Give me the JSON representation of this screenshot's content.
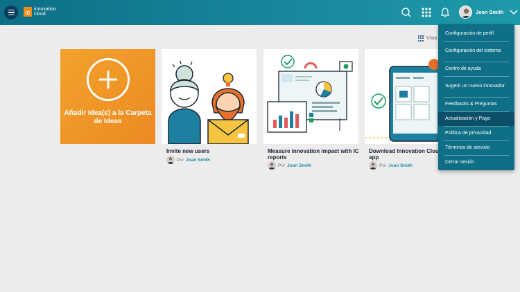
{
  "header": {
    "logo_text_line1": "innovation",
    "logo_text_line2": "cloud",
    "logo_mark": "IC",
    "user_name": "Joan Smith",
    "icons": [
      "menu-icon",
      "search-icon",
      "apps-grid-icon",
      "bell-icon",
      "chevron-down-icon"
    ]
  },
  "view_toggle": {
    "label": "Vista"
  },
  "add_card": {
    "label": "Añadir Idea(s) a la Carpeta de Ideas"
  },
  "cards": [
    {
      "title": "Invite new users",
      "author_prefix": "Por",
      "author_name": "Joan Smith"
    },
    {
      "title": "Measure innovation impact with IC reports",
      "author_prefix": "Por",
      "author_name": "Joan Smith"
    },
    {
      "title": "Download Innovation Cloud mobile app",
      "author_prefix": "Por",
      "author_name": "Joan Smith"
    }
  ],
  "dropdown": {
    "items": [
      "Configuración de perfil",
      "Configuración del sistema",
      "Centro de ayuda",
      "Sugerir un nuevo innovador",
      "Feedbacks & Preguntas",
      "Actualización y Pago",
      "Política de privacidad",
      "Términos de servicio",
      "Cerrar sesión"
    ],
    "active_index": 5
  },
  "colors": {
    "topbar": "#17889c",
    "accent_orange": "#ec8a22",
    "dropdown_bg": "#0e6f86",
    "author_link": "#1d8ca6"
  }
}
